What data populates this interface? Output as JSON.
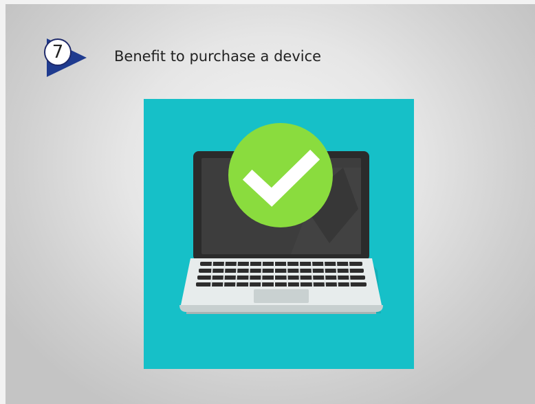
{
  "step": {
    "number": "7",
    "arrow_color": "#1f3b8f"
  },
  "slide": {
    "title": "Benefit to purchase a device"
  },
  "illustration": {
    "icon": "laptop-with-checkmark",
    "background_color": "#16c0c8",
    "check_color": "#8adc3e"
  }
}
